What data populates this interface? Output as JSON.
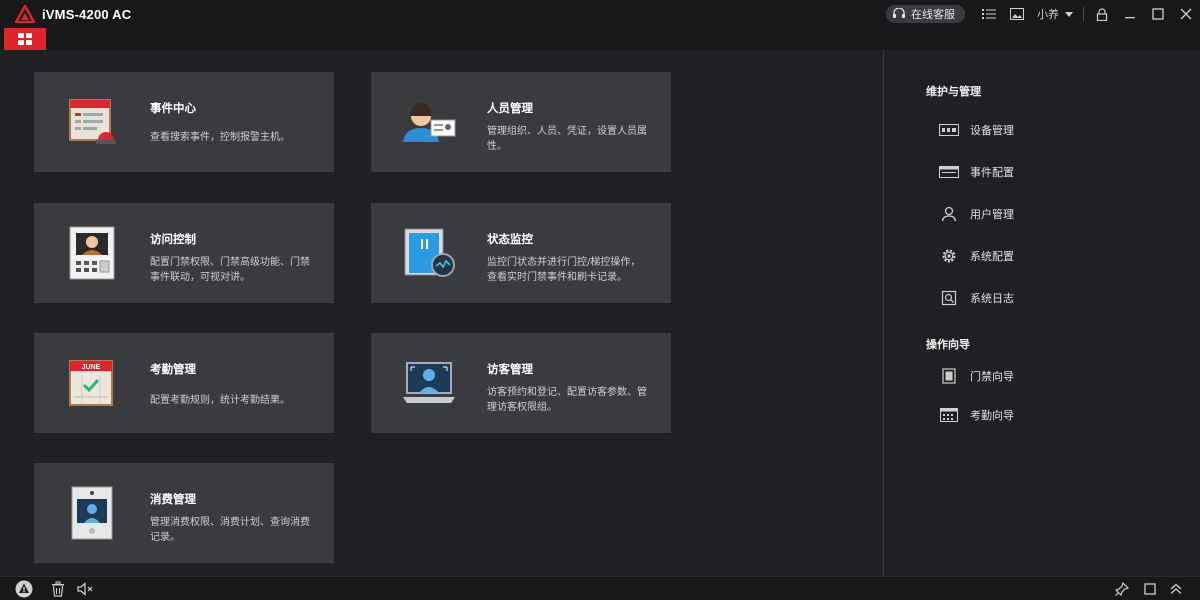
{
  "app": {
    "title": "iVMS-4200 AC"
  },
  "titlebar": {
    "support_label": "在线客服",
    "user_name": "小养"
  },
  "cards": [
    {
      "title": "事件中心",
      "desc": "查看搜索事件，控制报警主机。"
    },
    {
      "title": "人员管理",
      "desc": "管理组织、人员、凭证，设置人员属性。"
    },
    {
      "title": "访问控制",
      "desc": "配置门禁权限、门禁高级功能、门禁事件联动，可视对讲。"
    },
    {
      "title": "状态监控",
      "desc": "监控门状态并进行门控/梯控操作，查看实时门禁事件和刷卡记录。"
    },
    {
      "title": "考勤管理",
      "desc": "配置考勤规则，统计考勤结果。"
    },
    {
      "title": "访客管理",
      "desc": "访客预约和登记、配置访客参数、管理访客权限组。"
    },
    {
      "title": "消费管理",
      "desc": "管理消费权限、消费计划、查询消费记录。"
    }
  ],
  "sidebar": {
    "section1": {
      "title": "维护与管理",
      "items": [
        {
          "label": "设备管理",
          "icon": "device-icon"
        },
        {
          "label": "事件配置",
          "icon": "event-config-icon"
        },
        {
          "label": "用户管理",
          "icon": "user-icon"
        },
        {
          "label": "系统配置",
          "icon": "gear-icon"
        },
        {
          "label": "系统日志",
          "icon": "log-icon"
        }
      ]
    },
    "section2": {
      "title": "操作向导",
      "items": [
        {
          "label": "门禁向导",
          "icon": "door-icon"
        },
        {
          "label": "考勤向导",
          "icon": "calendar-icon"
        }
      ]
    }
  },
  "calendar_label": "JUNE",
  "colors": {
    "accent": "#e0242c",
    "card_bg": "#3a3b3f",
    "background": "#1f2023",
    "bar_bg": "#17181a"
  }
}
